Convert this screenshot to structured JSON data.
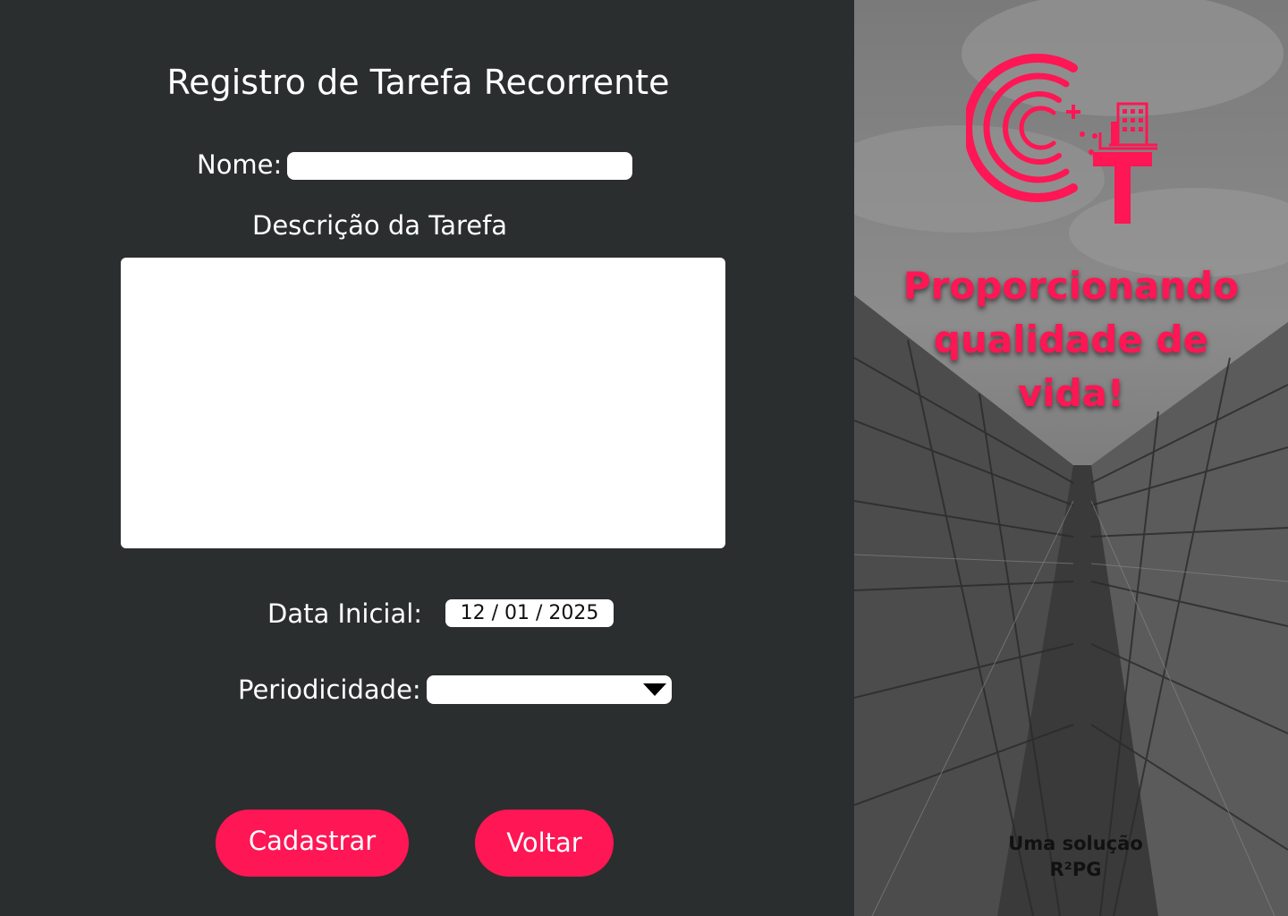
{
  "form": {
    "title": "Registro de Tarefa Recorrente",
    "nome_label": "Nome:",
    "nome_value": "",
    "descricao_label": "Descrição da Tarefa",
    "descricao_value": "",
    "data_label": "Data Inicial:",
    "data_value": "12 / 01 / 2025",
    "periodicidade_label": "Periodicidade:",
    "periodicidade_value": "",
    "submit_label": "Cadastrar",
    "back_label": "Voltar"
  },
  "brand": {
    "logo_icon": "ct-building-logo-icon",
    "slogan_line1": "Proporcionando",
    "slogan_line2": "qualidade de",
    "slogan_line3": "vida!",
    "credit_line1": "Uma solução",
    "credit_line2": "R²PG"
  },
  "colors": {
    "accent": "#ff1654",
    "panel_bg": "#2b2e2f"
  }
}
